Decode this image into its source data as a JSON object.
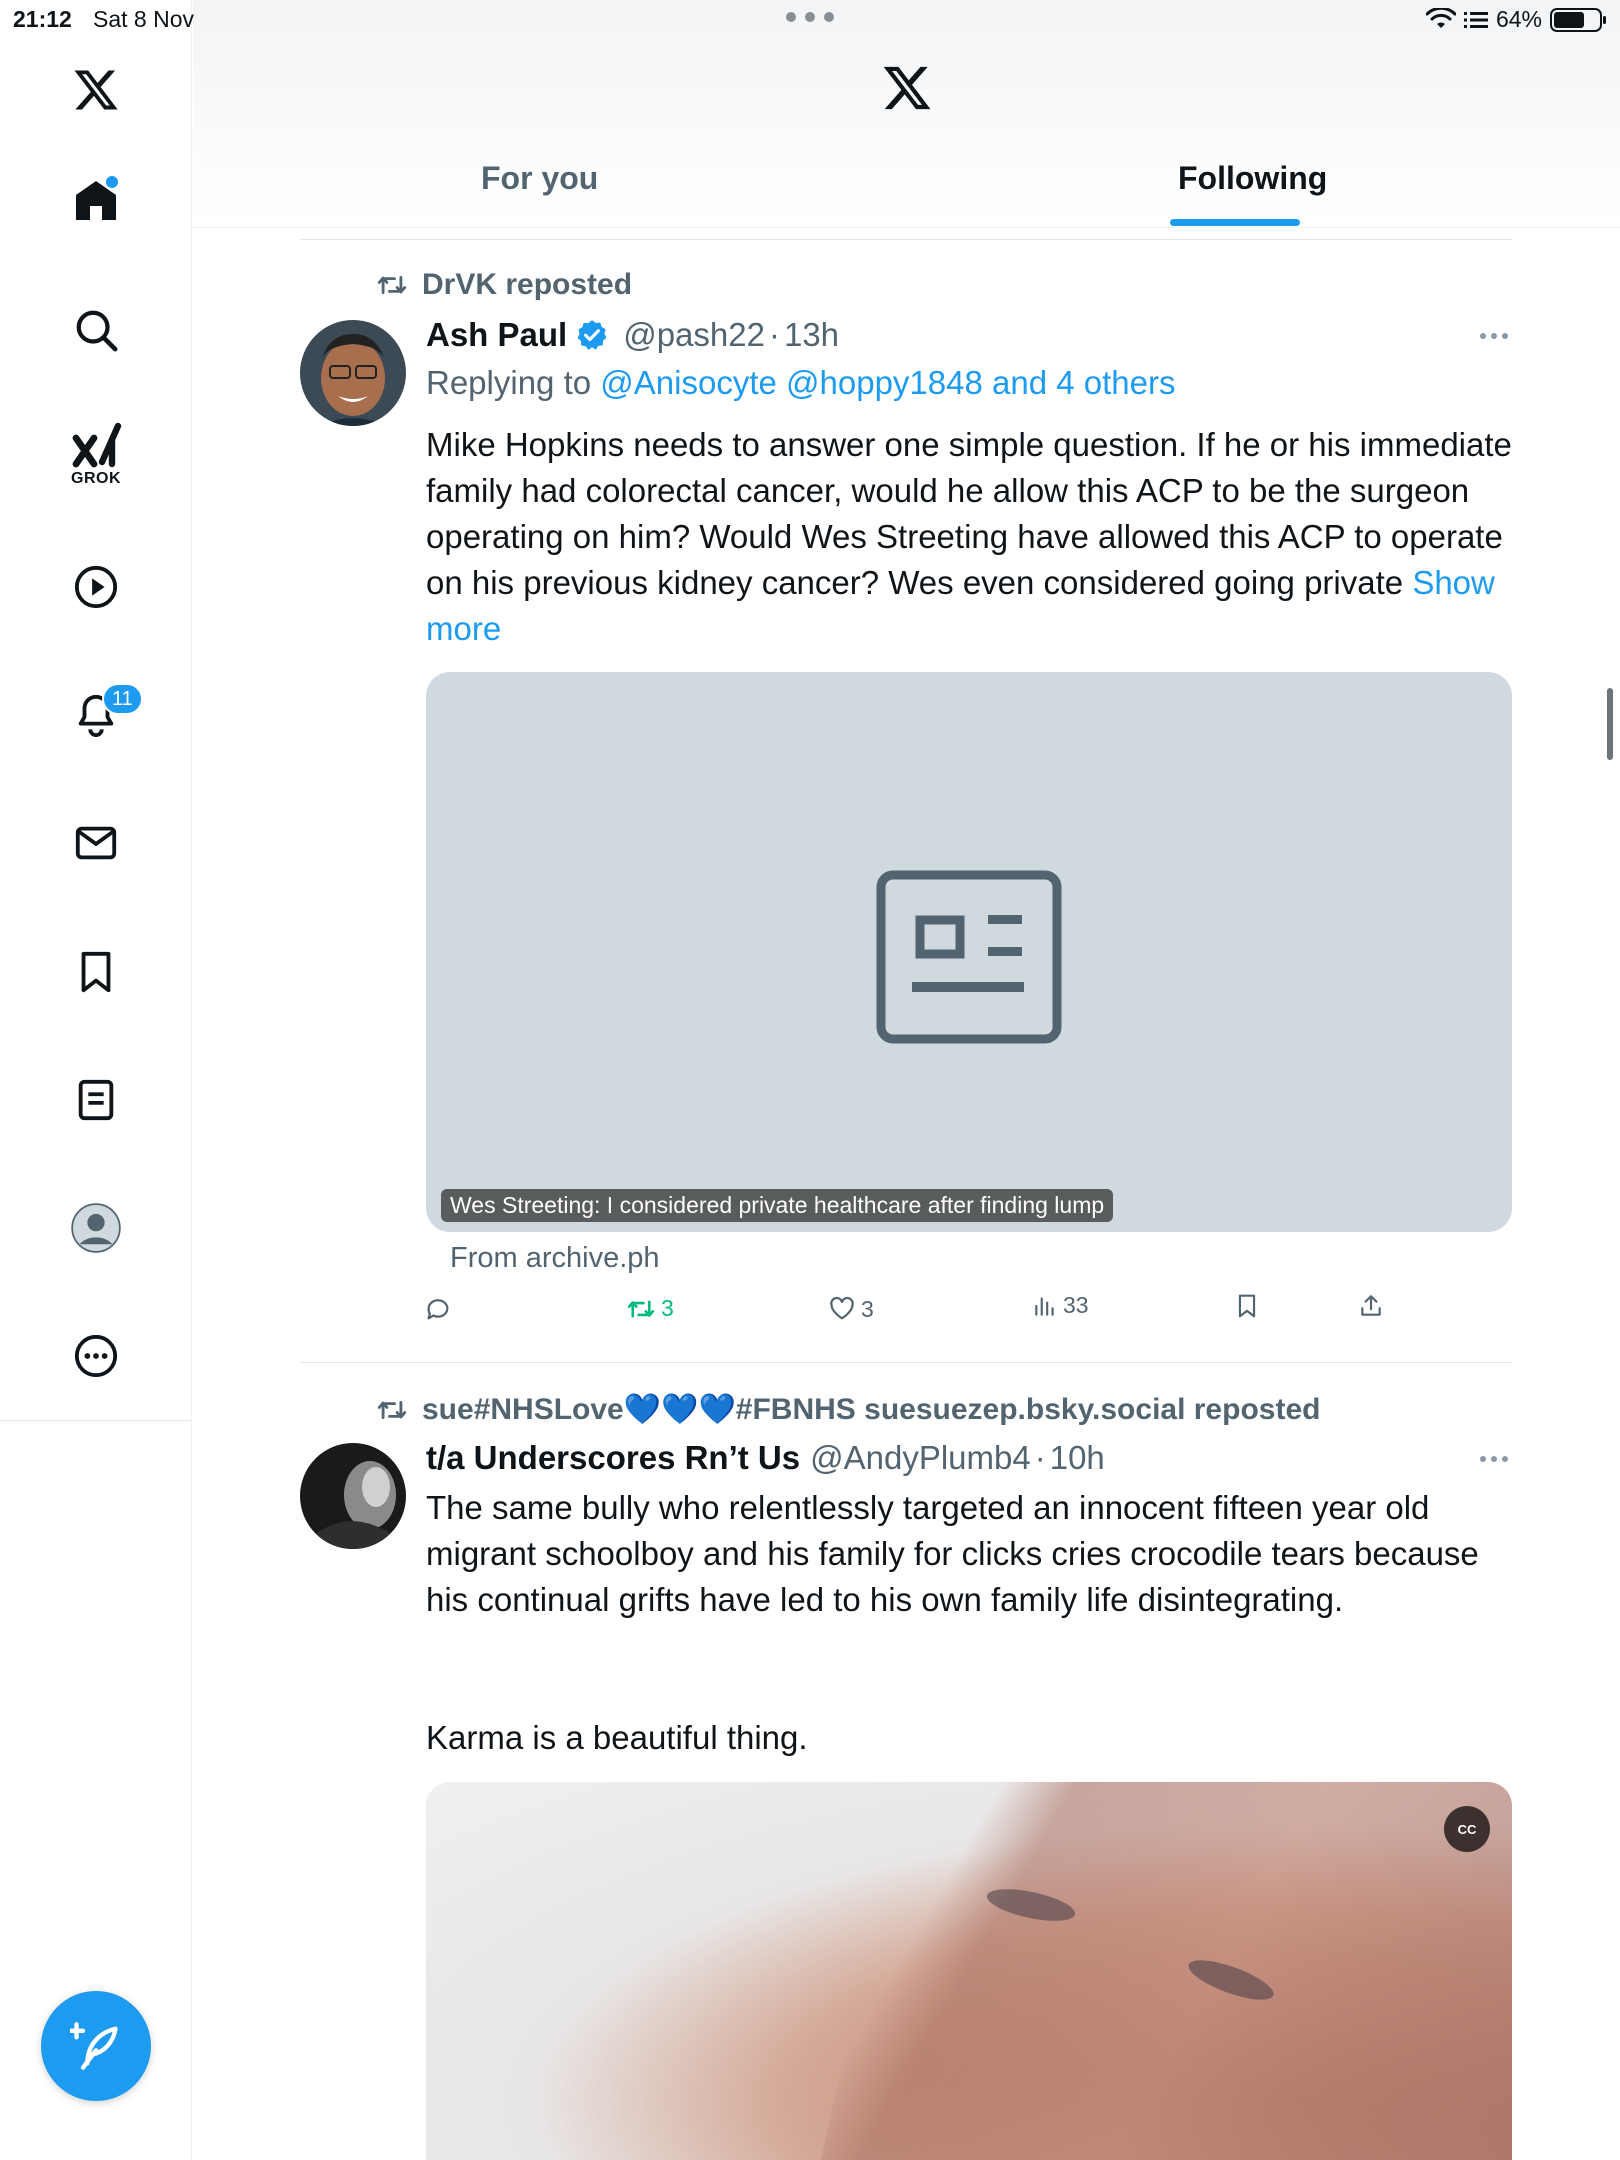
{
  "status_bar": {
    "time": "21:12",
    "date": "Sat 8 Nov",
    "battery": "64%"
  },
  "sidebar": {
    "grok_label": "GROK",
    "notifications_count": "11"
  },
  "header": {
    "tabs": [
      {
        "label": "For you",
        "active": false
      },
      {
        "label": "Following",
        "active": true
      }
    ]
  },
  "tweets": [
    {
      "repost_by": "DrVK reposted",
      "name": "Ash Paul",
      "verified": true,
      "handle": "@pash22",
      "separator": "·",
      "time": "13h",
      "replying_prefix": "Replying to",
      "replying_to": "@Anisocyte @hoppy1848 and 4 others",
      "text": "Mike Hopkins needs to answer one simple question. If he or his immediate family had colorectal cancer, would he allow this ACP to be the surgeon operating on him? Would Wes Streeting have allowed this ACP to operate on his previous kidney cancer? Wes even considered going private",
      "show_more": "Show more",
      "card": {
        "caption": "Wes Streeting: I considered private healthcare after finding lump",
        "source": "From archive.ph"
      },
      "stats": {
        "replies": "",
        "reposts": "3",
        "likes": "3",
        "views": "33"
      }
    },
    {
      "repost_by": "sue#NHSLove💙💙💙#FBNHS suesuezep.bsky.social reposted",
      "name": "t/a Underscores Rn’t Us",
      "handle": "@AndyPlumb4",
      "separator": "·",
      "time": "10h",
      "text_p1": "The same bully who relentlessly targeted an innocent fifteen year old migrant schoolboy and his family for clicks cries crocodile tears because his continual grifts have led to his own family life disintegrating.",
      "text_p2": "Karma is a beautiful thing.",
      "media_badge": "CC"
    }
  ],
  "colors": {
    "accent": "#1d9bf0",
    "repost_green": "#00ba7c",
    "secondary_text": "#536471"
  }
}
